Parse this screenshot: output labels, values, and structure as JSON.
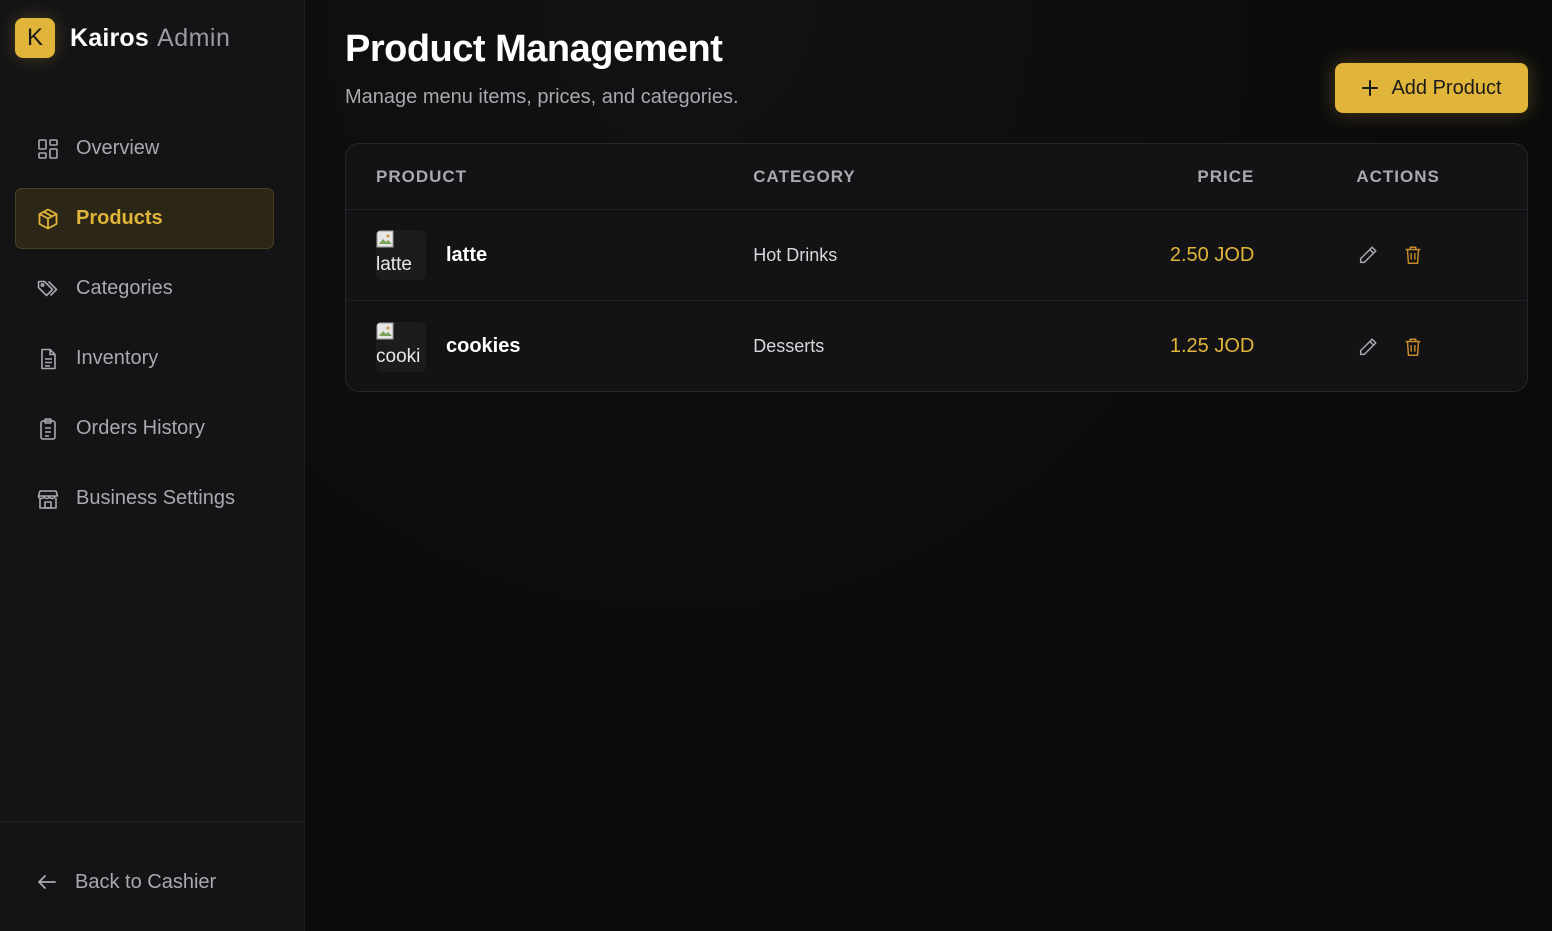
{
  "brand": {
    "logo_letter": "K",
    "name": "Kairos",
    "suffix": "Admin",
    "accent": "#e0b53a"
  },
  "sidebar": {
    "items": [
      {
        "label": "Overview",
        "icon": "grid-icon",
        "active": false
      },
      {
        "label": "Products",
        "icon": "box-icon",
        "active": true
      },
      {
        "label": "Categories",
        "icon": "tag-icon",
        "active": false
      },
      {
        "label": "Inventory",
        "icon": "document-icon",
        "active": false
      },
      {
        "label": "Orders History",
        "icon": "clipboard-icon",
        "active": false
      },
      {
        "label": "Business Settings",
        "icon": "store-icon",
        "active": false
      }
    ],
    "back_label": "Back to Cashier"
  },
  "main": {
    "title": "Product Management",
    "subtitle": "Manage menu items, prices, and categories.",
    "add_button_label": "Add Product"
  },
  "table": {
    "columns": [
      "PRODUCT",
      "CATEGORY",
      "PRICE",
      "ACTIONS"
    ],
    "rows": [
      {
        "image_alt": "latte",
        "name": "latte",
        "category": "Hot Drinks",
        "price": "2.50 JOD"
      },
      {
        "image_alt": "cooki",
        "name": "cookies",
        "category": "Desserts",
        "price": "1.25 JOD"
      }
    ]
  }
}
